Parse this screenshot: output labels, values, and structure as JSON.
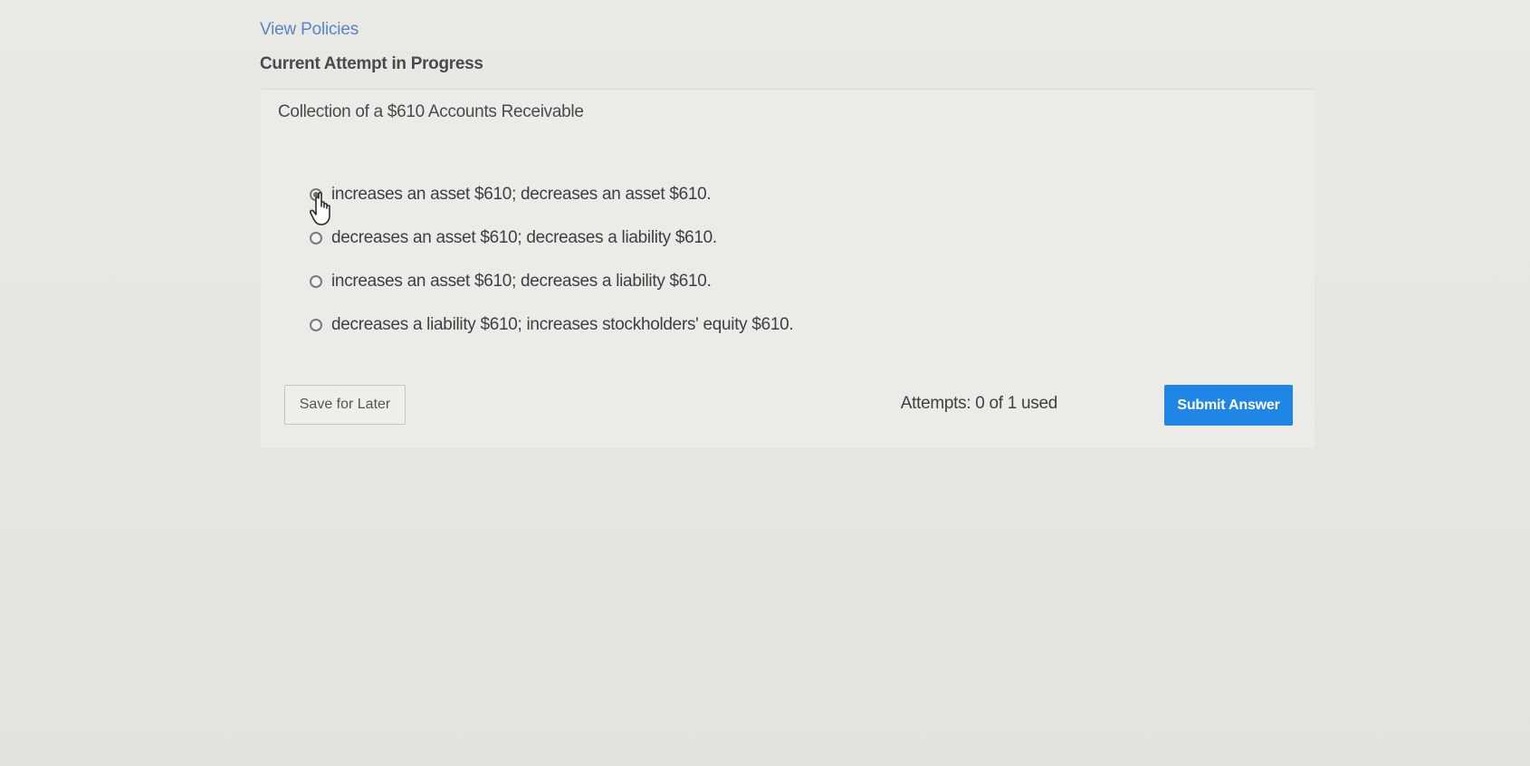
{
  "header": {
    "view_policies_label": "View Policies",
    "attempt_heading": "Current Attempt in Progress"
  },
  "question": {
    "text": "Collection of a $610 Accounts Receivable",
    "selected_index": 0,
    "choices": [
      {
        "label": "increases an asset $610; decreases an asset $610.",
        "selected": true
      },
      {
        "label": "decreases an asset $610; decreases a liability $610.",
        "selected": false
      },
      {
        "label": "increases an asset $610; decreases a liability $610.",
        "selected": false
      },
      {
        "label": "decreases a liability $610; increases stockholders' equity $610.",
        "selected": false
      }
    ]
  },
  "footer": {
    "save_label": "Save for Later",
    "attempts_text": "Attempts: 0 of 1 used",
    "submit_label": "Submit Answer"
  },
  "colors": {
    "link": "#5b86c4",
    "submit_background": "#1f86e6",
    "page_background": "#e7e7e2"
  },
  "icons": {
    "cursor": "hand-pointer-icon"
  }
}
